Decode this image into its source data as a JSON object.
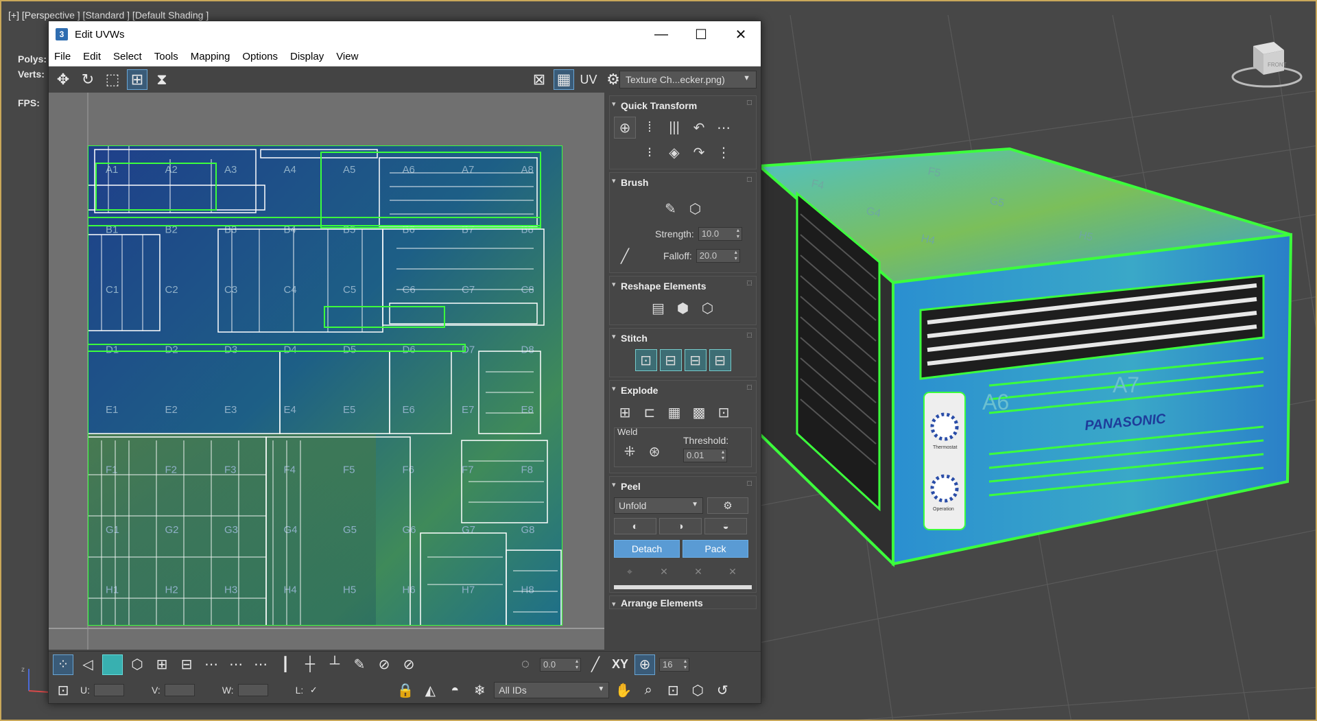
{
  "viewport": {
    "label": "[+] [Perspective ] [Standard ] [Default Shading ]",
    "stats": {
      "polys": "Polys:",
      "verts": "Verts:",
      "fps": "FPS:"
    },
    "viewcube_label": "FRONT",
    "model_brand": "PANASONIC",
    "model_knob_labels": [
      "Thermostat",
      "Operation"
    ],
    "top_face_labels": [
      "F4",
      "F5",
      "G4",
      "G5",
      "H4",
      "H5"
    ],
    "front_face_labels": [
      "A6",
      "A7"
    ]
  },
  "window": {
    "title": "Edit UVWs",
    "title_icon": "3",
    "controls": {
      "minimize": "—",
      "maximize": "☐",
      "close": "✕"
    }
  },
  "menu": [
    "File",
    "Edit",
    "Select",
    "Tools",
    "Mapping",
    "Options",
    "Display",
    "View"
  ],
  "toolbar": {
    "uv_label": "UV",
    "texture_select": "Texture Ch...ecker.png)"
  },
  "uv_grid": {
    "labels": [
      [
        "A1",
        "A2",
        "A3",
        "A4",
        "A5",
        "A6",
        "A7",
        "A8"
      ],
      [
        "B1",
        "B2",
        "B3",
        "B4",
        "B5",
        "B6",
        "B7",
        "B8"
      ],
      [
        "C1",
        "C2",
        "C3",
        "C4",
        "C5",
        "C6",
        "C7",
        "C8"
      ],
      [
        "D1",
        "D2",
        "D3",
        "D4",
        "D5",
        "D6",
        "D7",
        "D8"
      ],
      [
        "E1",
        "E2",
        "E3",
        "E4",
        "E5",
        "E6",
        "E7",
        "E8"
      ],
      [
        "F1",
        "F2",
        "F3",
        "F4",
        "F5",
        "F6",
        "F7",
        "F8"
      ],
      [
        "G1",
        "G2",
        "G3",
        "G4",
        "G5",
        "G6",
        "G7",
        "G8"
      ],
      [
        "H1",
        "H2",
        "H3",
        "H4",
        "H5",
        "H6",
        "H7",
        "H8"
      ]
    ]
  },
  "panel": {
    "quick_transform": "Quick Transform",
    "brush": "Brush",
    "strength_label": "Strength:",
    "strength_value": "10.0",
    "falloff_label": "Falloff:",
    "falloff_value": "20.0",
    "reshape": "Reshape Elements",
    "stitch": "Stitch",
    "explode": "Explode",
    "weld_label": "Weld",
    "threshold_label": "Threshold:",
    "threshold_value": "0.01",
    "peel": "Peel",
    "unfold_option": "Unfold",
    "detach": "Detach",
    "pack": "Pack",
    "arrange": "Arrange Elements"
  },
  "bottom": {
    "rotate_value": "0.0",
    "xy_label": "XY",
    "grid_value": "16",
    "u_label": "U:",
    "v_label": "V:",
    "w_label": "W:",
    "l_label": "L:",
    "ids_select": "All IDs"
  },
  "colors": {
    "selection_green": "#3cff3c",
    "window_title_bg": "#ffffff",
    "panel_bg": "#444444",
    "accent_blue": "#5a9bd4"
  }
}
